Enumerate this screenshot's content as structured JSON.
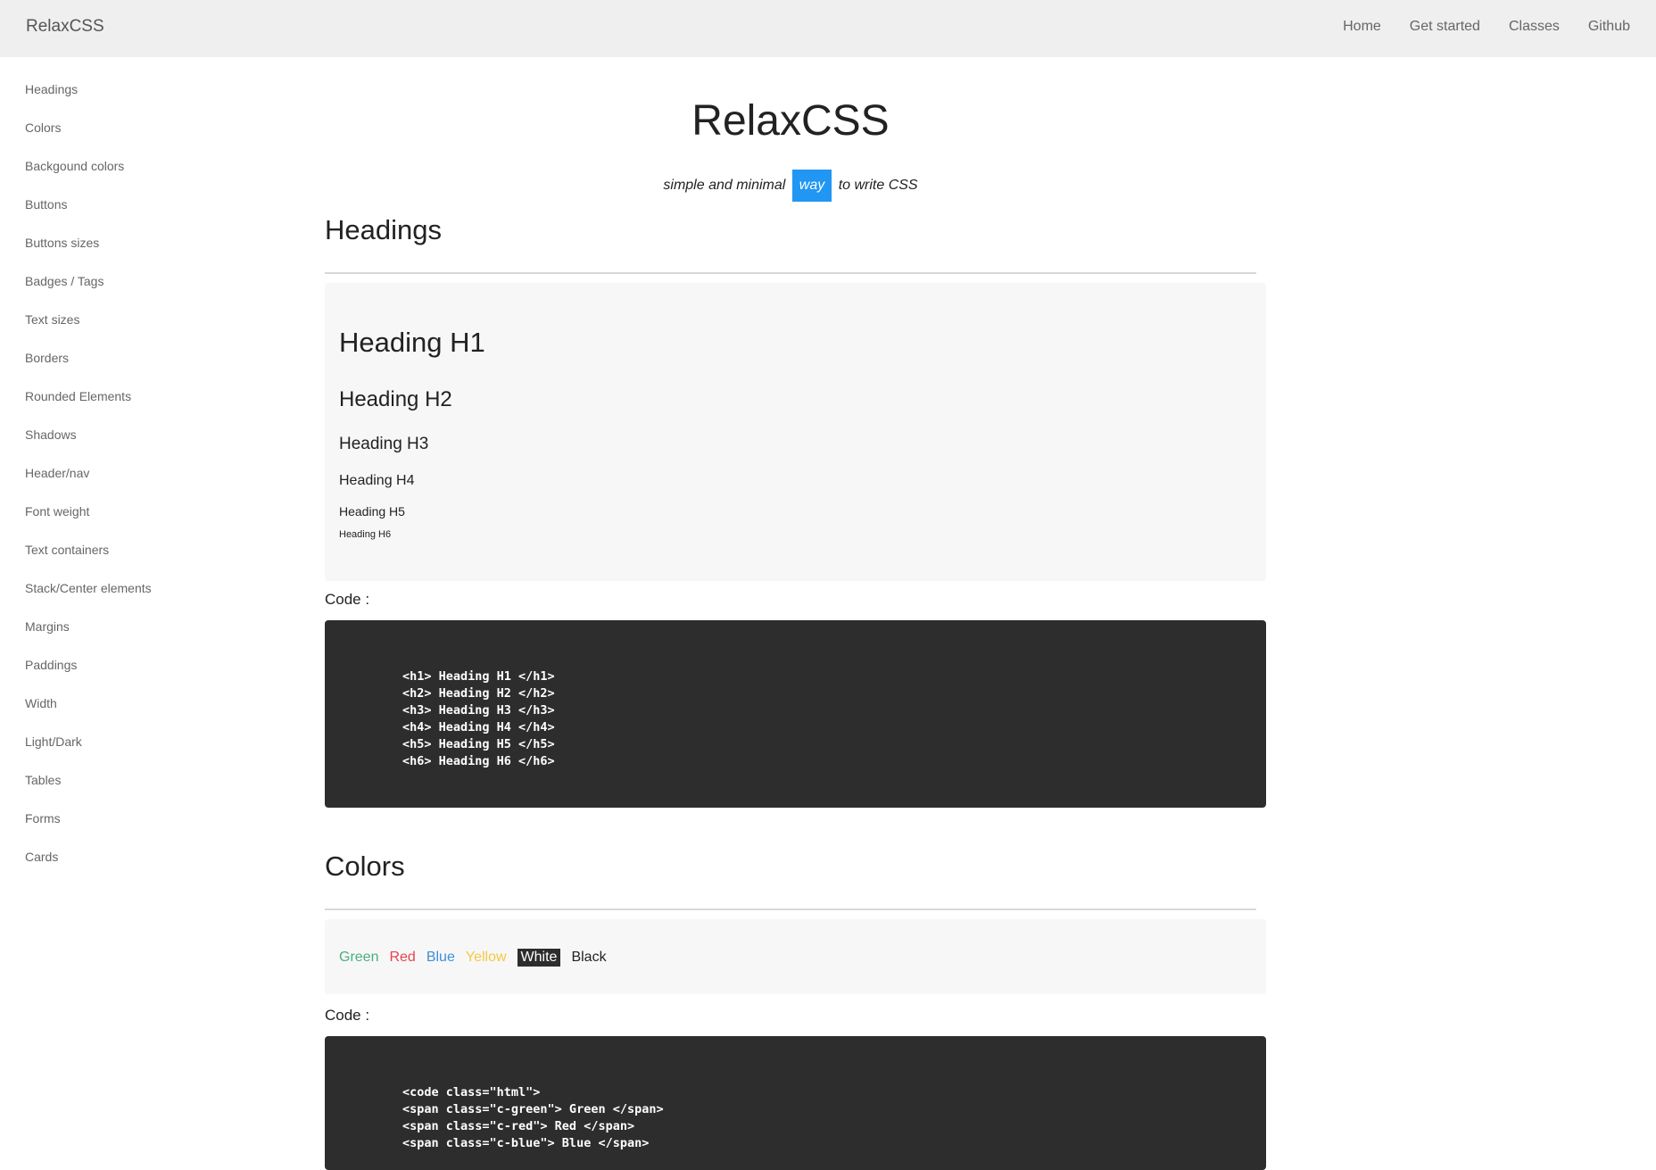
{
  "header": {
    "brand": "RelaxCSS",
    "nav": [
      "Home",
      "Get started",
      "Classes",
      "Github"
    ]
  },
  "sidebar": {
    "items": [
      "Headings",
      "Colors",
      "Backgound colors",
      "Buttons",
      "Buttons sizes",
      "Badges / Tags",
      "Text sizes",
      "Borders",
      "Rounded Elements",
      "Shadows",
      "Header/nav",
      "Font weight",
      "Text containers",
      "Stack/Center elements",
      "Margins",
      "Paddings",
      "Width",
      "Light/Dark",
      "Tables",
      "Forms",
      "Cards"
    ]
  },
  "hero": {
    "title": "RelaxCSS",
    "tagline_before": "simple and minimal",
    "tagline_highlight": "way",
    "tagline_after": "to write CSS"
  },
  "headings_section": {
    "title": "Headings",
    "demo": [
      "Heading H1",
      "Heading H2",
      "Heading H3",
      "Heading H4",
      "Heading H5",
      "Heading H6"
    ],
    "code_label": "Code :",
    "code": "<h1> Heading H1 </h1>\n<h2> Heading H2 </h2>\n<h3> Heading H3 </h3>\n<h4> Heading H4 </h4>\n<h5> Heading H5 </h5>\n<h6> Heading H6 </h6>"
  },
  "colors_section": {
    "title": "Colors",
    "swatches": [
      "Green",
      "Red",
      "Blue",
      "Yellow",
      "White",
      "Black"
    ],
    "code_label": "Code :",
    "code": "<code class=\"html\">\n<span class=\"c-green\"> Green </span>\n<span class=\"c-red\"> Red </span>\n<span class=\"c-blue\"> Blue </span>"
  },
  "colors": {
    "accent": "#2196f3",
    "code_bg": "#2d2d2d",
    "demo_bg": "#f7f7f7",
    "header_bg": "#efefef"
  }
}
